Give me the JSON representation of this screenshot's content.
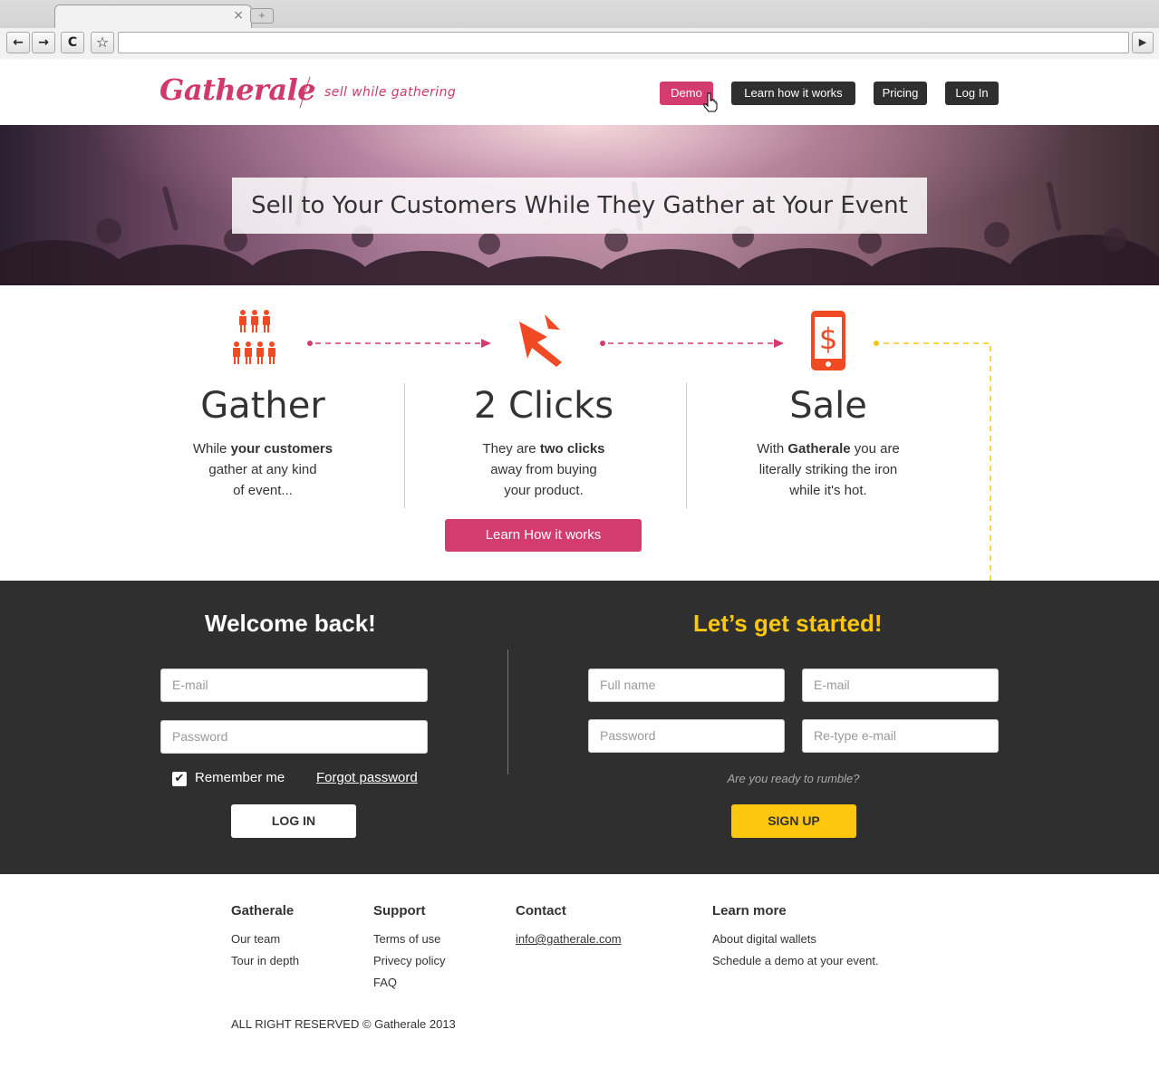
{
  "browser": {
    "tab_close": "×",
    "new_tab": "+",
    "back": "←",
    "forward": "→",
    "reload": "C",
    "bookmark": "☆",
    "go": "▶"
  },
  "header": {
    "logo": "Gatherale",
    "tagline": "sell while gathering",
    "nav": {
      "demo": "Demo",
      "learn": "Learn how it works",
      "pricing": "Pricing",
      "login": "Log In"
    }
  },
  "hero": {
    "title": "Sell to Your Customers While They Gather at Your Event"
  },
  "features": [
    {
      "title": "Gather",
      "text_pre": "While ",
      "text_bold": "your customers",
      "text_post_1": "gather at any kind",
      "text_post_2": "of event..."
    },
    {
      "title": "2 Clicks",
      "text_pre": "They are ",
      "text_bold": "two clicks",
      "text_post_1": "away from buying",
      "text_post_2": "your product."
    },
    {
      "title": "Sale",
      "text_pre": "With ",
      "text_bold": "Gatherale",
      "text_bold_after": " you are",
      "text_post_1": "literally striking the iron",
      "text_post_2": "while it's hot."
    }
  ],
  "learn_button": "Learn How it works",
  "login_form": {
    "title": "Welcome back!",
    "email_placeholder": "E-mail",
    "password_placeholder": "Password",
    "remember_label": "Remember me",
    "remember_checked": true,
    "checkmark": "✔",
    "forgot_label": "Forgot password",
    "submit": "LOG IN"
  },
  "signup_form": {
    "title": "Let’s get started!",
    "fullname_placeholder": "Full name",
    "email_placeholder": "E-mail",
    "password_placeholder": "Password",
    "retype_placeholder": "Re-type e-mail",
    "prompt": "Are you ready to rumble?",
    "submit": "SIGN UP"
  },
  "footer": {
    "columns": [
      {
        "heading": "Gatherale",
        "links": [
          "Our team",
          "Tour in depth"
        ]
      },
      {
        "heading": "Support",
        "links": [
          "Terms of use",
          "Privecy policy",
          "FAQ"
        ]
      },
      {
        "heading": "Contact",
        "links": [
          "info@gatherale.com"
        ]
      },
      {
        "heading": "Learn more",
        "links": [
          "About digital wallets",
          "Schedule a demo at your event."
        ]
      }
    ],
    "copyright": "ALL RIGHT RESERVED © Gatherale 2013"
  },
  "colors": {
    "brand_pink": "#d33c6f",
    "accent_yellow": "#fdc70f",
    "icon_red": "#f04a24",
    "dark_bg": "#2f2f2f"
  },
  "icons": [
    "people-icon",
    "cursor-arrow-icon",
    "phone-dollar-icon",
    "hand-cursor-icon"
  ]
}
